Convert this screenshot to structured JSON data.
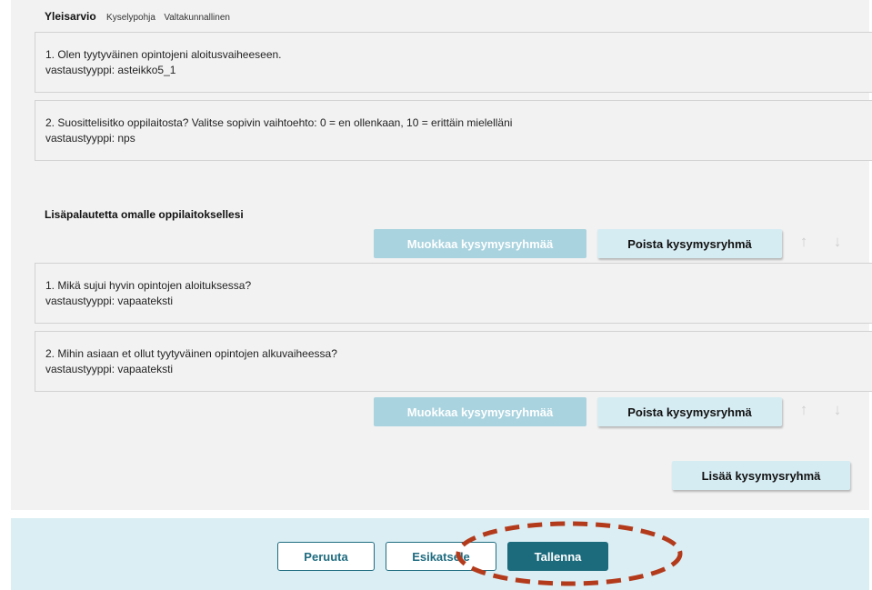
{
  "group1": {
    "title": "Yleisarvio",
    "tags": [
      "Kyselypohja",
      "Valtakunnallinen"
    ],
    "questions": [
      {
        "text": "1. Olen tyytyväinen opintojeni aloitusvaiheeseen.",
        "type": "vastaustyyppi: asteikko5_1"
      },
      {
        "text": "2. Suosittelisitko oppilaitosta? Valitse sopivin vaihtoehto: 0 = en ollenkaan, 10 = erittäin mielelläni",
        "type": "vastaustyyppi: nps"
      }
    ]
  },
  "group2": {
    "title": "Lisäpalautetta omalle oppilaitoksellesi",
    "questions": [
      {
        "text": "1. Mikä sujui hyvin opintojen aloituksessa?",
        "type": "vastaustyyppi: vapaateksti"
      },
      {
        "text": "2. Mihin asiaan et ollut tyytyväinen opintojen alkuvaiheessa?",
        "type": "vastaustyyppi: vapaateksti"
      }
    ]
  },
  "actions": {
    "edit_group": "Muokkaa kysymysryhmää",
    "delete_group": "Poista kysymysryhmä",
    "move_up": "↑",
    "move_down": "↓",
    "add_group": "Lisää kysymysryhmä"
  },
  "footer": {
    "cancel": "Peruuta",
    "preview": "Esikatsele",
    "save": "Tallenna"
  },
  "colors": {
    "primary": "#1c6b7c",
    "disabled_button": "#a9d3df",
    "light_button": "#d6ecf3",
    "footer_bg": "#dbeef4",
    "annotation": "#b33a1b"
  }
}
